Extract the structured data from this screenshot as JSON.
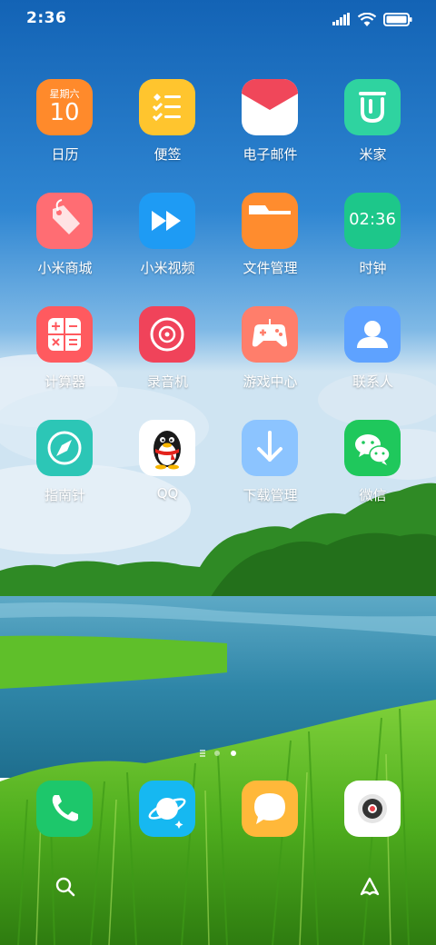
{
  "status_bar": {
    "time": "2:36",
    "signal_icon": "cellular-signal-icon",
    "wifi_icon": "wifi-icon",
    "battery_icon": "battery-icon"
  },
  "grid": {
    "apps": [
      {
        "label": "日历",
        "icon": "calendar-icon",
        "color": "#FF8A2B",
        "icon_text_top": "星期六",
        "icon_text_main": "10"
      },
      {
        "label": "便签",
        "icon": "notes-icon",
        "color": "#FFC52E"
      },
      {
        "label": "电子邮件",
        "icon": "email-icon",
        "color": "#FFFFFF"
      },
      {
        "label": "米家",
        "icon": "mijia-icon",
        "color": "#2FD3A0"
      },
      {
        "label": "小米商城",
        "icon": "shop-tag-icon",
        "color": "#FF6D73"
      },
      {
        "label": "小米视频",
        "icon": "video-play-icon",
        "color": "#1E9BF4"
      },
      {
        "label": "文件管理",
        "icon": "folder-icon",
        "color": "#FF8C2E"
      },
      {
        "label": "时钟",
        "icon": "clock-icon",
        "color": "#1DC78A",
        "icon_text_main": "02:36"
      },
      {
        "label": "计算器",
        "icon": "calculator-icon",
        "color": "#FF5A5F"
      },
      {
        "label": "录音机",
        "icon": "recorder-icon",
        "color": "#F0435A"
      },
      {
        "label": "游戏中心",
        "icon": "gamepad-icon",
        "color": "#FF7E6B"
      },
      {
        "label": "联系人",
        "icon": "contacts-icon",
        "color": "#5EA2FF"
      },
      {
        "label": "指南针",
        "icon": "compass-icon",
        "color": "#2CC6B6"
      },
      {
        "label": "QQ",
        "icon": "qq-penguin-icon",
        "color": "#FFFFFF"
      },
      {
        "label": "下载管理",
        "icon": "download-icon",
        "color": "#8CC4FF"
      },
      {
        "label": "微信",
        "icon": "wechat-icon",
        "color": "#1FC85C"
      }
    ]
  },
  "page_indicator": {
    "pages": [
      "search",
      "page-1",
      "page-2"
    ],
    "active_index": 2
  },
  "dock": {
    "apps": [
      {
        "icon": "phone-icon",
        "color": "#1DC76B"
      },
      {
        "icon": "browser-planet-icon",
        "color": "#16B8F1"
      },
      {
        "icon": "messages-icon",
        "color": "#FFB83A"
      },
      {
        "icon": "camera-icon",
        "color": "#FFFFFF"
      }
    ]
  },
  "bottom": {
    "left_icon": "search-icon",
    "right_icon": "app-vault-icon"
  }
}
